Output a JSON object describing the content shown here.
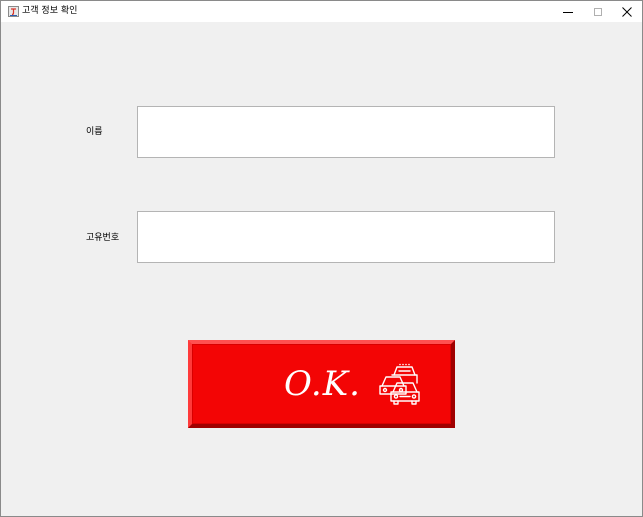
{
  "window": {
    "title": "고객 정보 확인",
    "controls": {
      "minimize_icon": "minimize-icon",
      "maximize_icon": "maximize-icon",
      "close_icon": "close-icon"
    }
  },
  "form": {
    "name_label": "이름",
    "name_value": "",
    "id_label": "고유번호",
    "id_value": ""
  },
  "ok_button": {
    "label": "O.K.",
    "icon": "cars-icon",
    "background_color": "#f30505",
    "text_color": "#ffffff"
  }
}
